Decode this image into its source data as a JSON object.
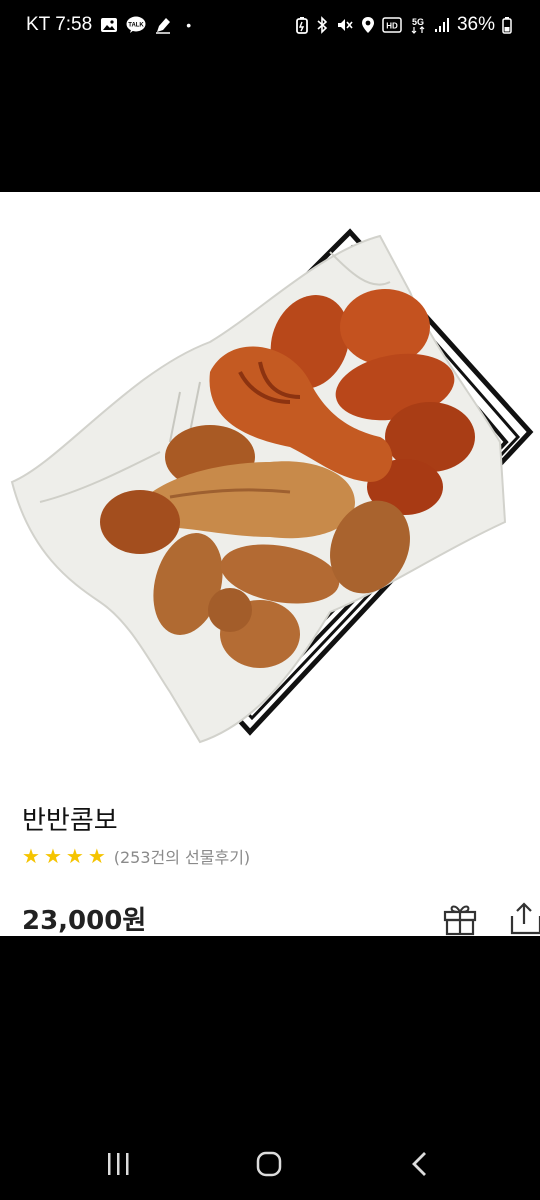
{
  "status_bar": {
    "carrier_time": "KT 7:58",
    "dot": "•",
    "battery": "36%",
    "left_icons": [
      "gallery-icon",
      "talk-icon",
      "pen-icon"
    ],
    "right_icons": [
      "battery-saver-icon",
      "bluetooth-icon",
      "mute-icon",
      "location-icon",
      "hd-icon",
      "5g-icon",
      "signal-icon",
      "battery-icon"
    ],
    "talk_label": "TALK",
    "hd_label": "HD",
    "fiveg_label": "5G"
  },
  "product": {
    "image": "fried-chicken-basket-photo",
    "name": "반반콤보",
    "rating": 4,
    "rating_max": 4,
    "review_text": "(253건의 선물후기)",
    "price": "23,000원"
  },
  "actions": {
    "gift_icon": "gift-icon",
    "share_icon": "share-icon"
  },
  "colors": {
    "star": "#f5c400",
    "review_text": "#8a8a8a"
  },
  "nav": [
    "recent-apps-icon",
    "home-icon",
    "back-icon"
  ]
}
